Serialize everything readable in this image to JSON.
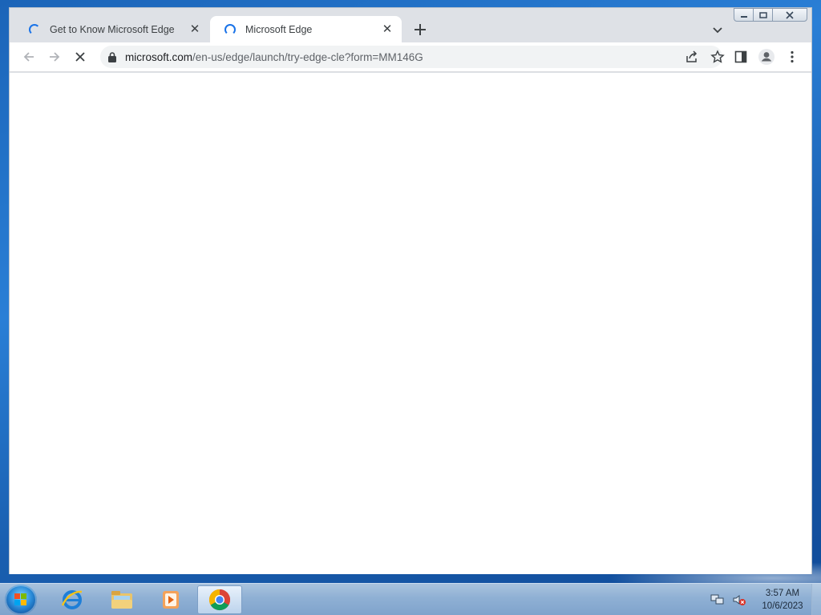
{
  "browser": {
    "tabs": [
      {
        "title": "Get to Know Microsoft Edge",
        "active": false
      },
      {
        "title": "Microsoft Edge",
        "active": true
      }
    ],
    "address": {
      "host": "microsoft.com",
      "path": "/en-us/edge/launch/try-edge-cle?form=MM146G"
    },
    "icons": {
      "back": "back-arrow-icon",
      "forward": "forward-arrow-icon",
      "stop": "stop-loading-icon",
      "share": "share-icon",
      "bookmark": "star-icon",
      "side_panel": "side-panel-icon",
      "profile": "profile-icon",
      "menu": "kebab-menu-icon"
    },
    "accent": "#1a73e8"
  },
  "taskbar": {
    "apps": [
      {
        "name": "internet-explorer",
        "active": false
      },
      {
        "name": "windows-explorer",
        "active": false
      },
      {
        "name": "media-player",
        "active": false
      },
      {
        "name": "google-chrome",
        "active": true
      }
    ],
    "clock": {
      "time": "3:57 AM",
      "date": "10/6/2023"
    }
  }
}
